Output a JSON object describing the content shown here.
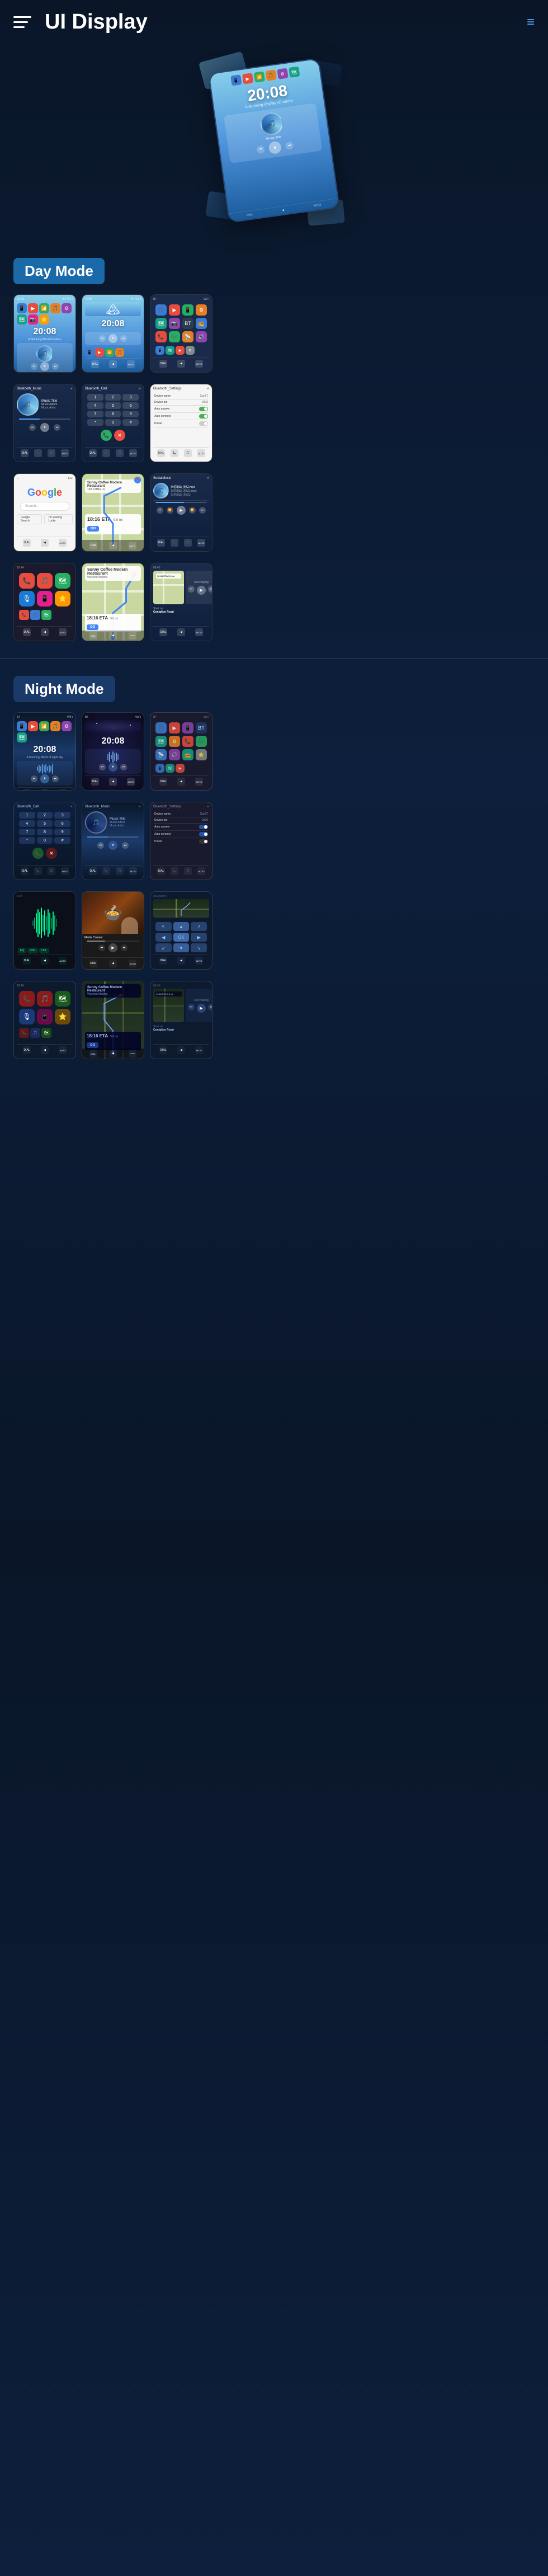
{
  "header": {
    "title": "UI Display",
    "menu_icon": "menu-icon"
  },
  "sections": {
    "day_mode": {
      "label": "Day Mode"
    },
    "night_mode": {
      "label": "Night Mode"
    }
  },
  "screens": {
    "time": "20:08",
    "music_title": "Music Title",
    "music_album": "Music Album",
    "music_artist": "Music Artist",
    "bluetooth_music": "Bluetooth_Music",
    "bluetooth_call": "Bluetooth_Call",
    "bluetooth_settings": "Bluetooth_Settings",
    "device_name_label": "Device name",
    "device_name_val": "CarBT",
    "device_pin_label": "Device pin",
    "device_pin_val": "0000",
    "auto_answer_label": "Auto answer",
    "auto_connect_label": "Auto connect",
    "power_label": "Power",
    "google_text": "Google",
    "social_music": "SocialMusic",
    "nav_restaurant": "Sunny Coffee Modern Restaurant",
    "nav_address": "123 Main Street",
    "go_btn": "GO",
    "eta_time": "18:16 ETA",
    "eta_dist": "9.0 mi",
    "not_playing": "Not Playing",
    "start_on": "Start on",
    "coniglioe_road": "Coniglioe Road"
  }
}
